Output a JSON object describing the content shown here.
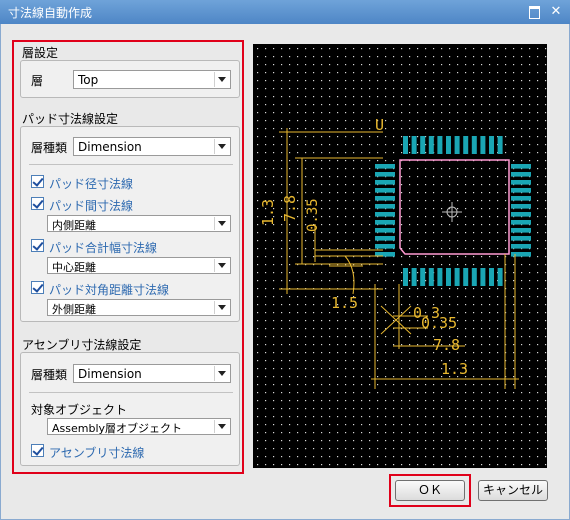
{
  "window": {
    "title": "寸法線自動作成",
    "maximize_glyph": "",
    "close_glyph": "✕"
  },
  "layer_section": {
    "title": "層設定",
    "layer_label": "層",
    "layer_value": "Top"
  },
  "pad_section": {
    "title": "パッド寸法線設定",
    "layer_type_label": "層種類",
    "layer_type_value": "Dimension",
    "options": [
      {
        "label": "パッド径寸法線",
        "checked": true
      },
      {
        "label": "パッド間寸法線",
        "checked": true,
        "mode": "内側距離"
      },
      {
        "label": "パッド合計幅寸法線",
        "checked": true,
        "mode": "中心距離"
      },
      {
        "label": "パッド対角距離寸法線",
        "checked": true,
        "mode": "外側距離"
      }
    ]
  },
  "assembly_section": {
    "title": "アセンブリ寸法線設定",
    "layer_type_label": "層種類",
    "layer_type_value": "Dimension",
    "target_label": "対象オブジェクト",
    "target_value": "Assembly層オブジェクト",
    "assembly_option": {
      "label": "アセンブリ寸法線",
      "checked": true
    }
  },
  "preview": {
    "pin1_label": "U",
    "dim_labels": [
      "1.3",
      "7.8",
      "0.35",
      "1.5",
      "0.3",
      "0.35",
      "7.8",
      "1.3"
    ],
    "colors": {
      "background": "#000000",
      "grid_dot": "#d8d8d8",
      "pad": "#1aa6b4",
      "outline": "#ff9ad2",
      "dimension": "#e8b830"
    }
  },
  "buttons": {
    "ok": "ＯＫ",
    "cancel": "キャンセル"
  }
}
